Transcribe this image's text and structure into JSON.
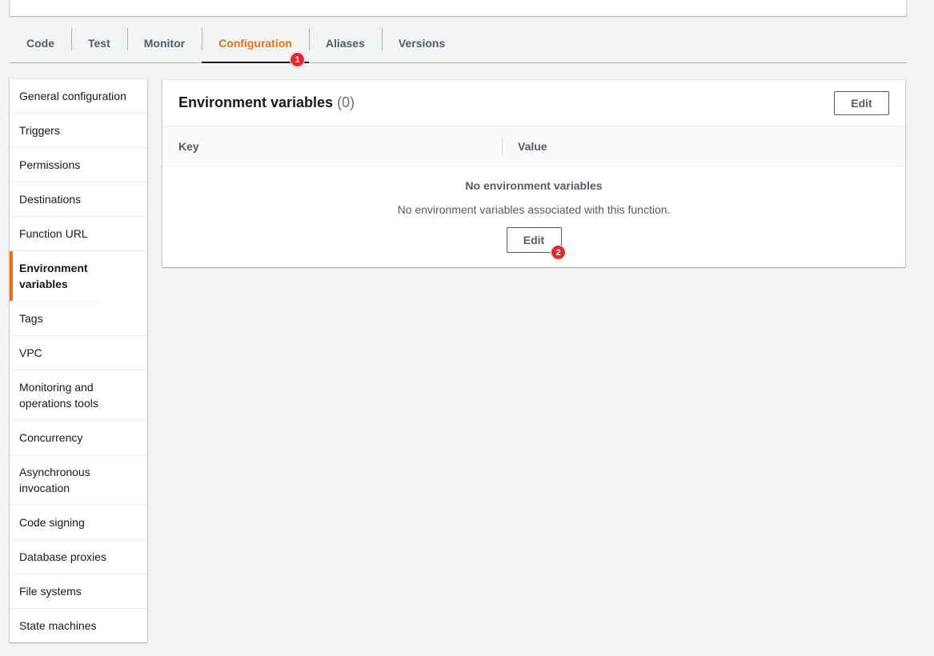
{
  "tabs": [
    {
      "label": "Code"
    },
    {
      "label": "Test"
    },
    {
      "label": "Monitor"
    },
    {
      "label": "Configuration",
      "active": true
    },
    {
      "label": "Aliases"
    },
    {
      "label": "Versions"
    }
  ],
  "annotations": {
    "step1": "1",
    "step2": "2"
  },
  "sidebar": {
    "items": [
      {
        "label": "General configuration"
      },
      {
        "label": "Triggers"
      },
      {
        "label": "Permissions"
      },
      {
        "label": "Destinations"
      },
      {
        "label": "Function URL"
      },
      {
        "label": "Environment variables",
        "active": true
      },
      {
        "label": "Tags"
      },
      {
        "label": "VPC"
      },
      {
        "label": "Monitoring and operations tools"
      },
      {
        "label": "Concurrency"
      },
      {
        "label": "Asynchronous invocation"
      },
      {
        "label": "Code signing"
      },
      {
        "label": "Database proxies"
      },
      {
        "label": "File systems"
      },
      {
        "label": "State machines"
      }
    ]
  },
  "panel": {
    "title": "Environment variables",
    "count": "(0)",
    "edit_label": "Edit",
    "columns": {
      "key": "Key",
      "value": "Value"
    },
    "empty": {
      "title": "No environment variables",
      "description": "No environment variables associated with this function.",
      "edit_label": "Edit"
    }
  },
  "colors": {
    "accent": "#ec7211",
    "badge": "#e5282b",
    "background": "#f2f3f3",
    "text": "#16191f",
    "muted": "#545b64"
  }
}
